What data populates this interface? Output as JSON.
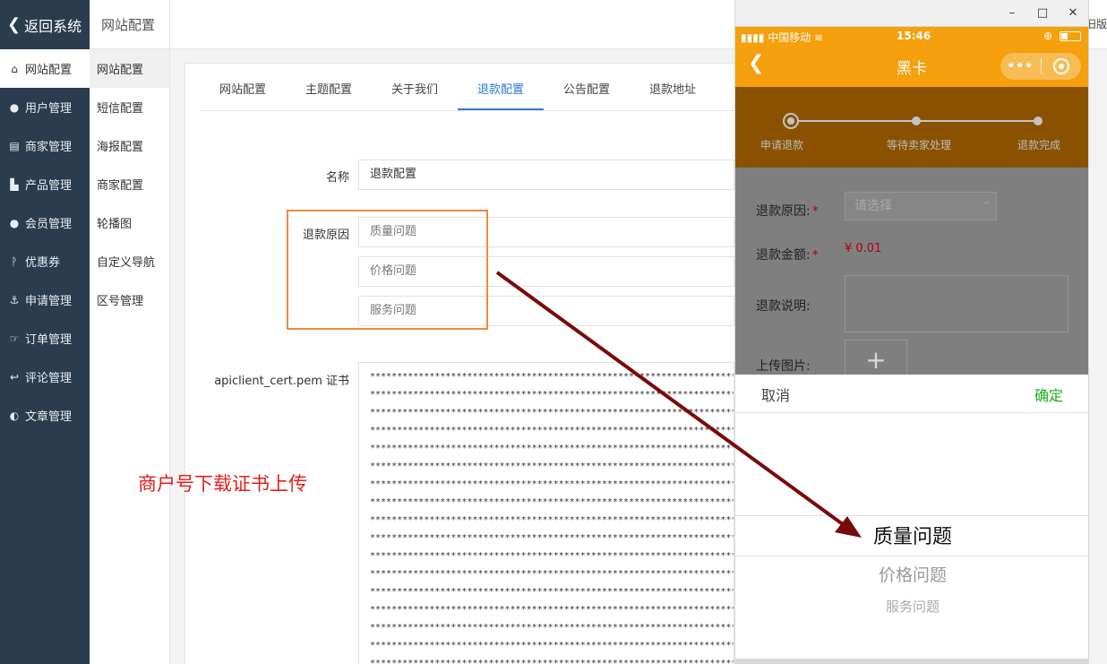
{
  "sidebar": {
    "back": "返回系统",
    "items": [
      {
        "label": "网站配置",
        "icon": "home-icon"
      },
      {
        "label": "用户管理",
        "icon": "user-icon"
      },
      {
        "label": "商家管理",
        "icon": "store-icon"
      },
      {
        "label": "产品管理",
        "icon": "cart-icon"
      },
      {
        "label": "会员管理",
        "icon": "members-icon"
      },
      {
        "label": "优惠券",
        "icon": "coupon-icon"
      },
      {
        "label": "申请管理",
        "icon": "anchor-icon"
      },
      {
        "label": "订单管理",
        "icon": "thumb-icon"
      },
      {
        "label": "评论管理",
        "icon": "reply-icon"
      },
      {
        "label": "文章管理",
        "icon": "half-circle-icon"
      }
    ]
  },
  "subbar": {
    "title": "网站配置",
    "items": [
      "网站配置",
      "短信配置",
      "海报配置",
      "商家配置",
      "轮播图",
      "自定义导航",
      "区号管理"
    ]
  },
  "topbar": {
    "old_version": "旧版"
  },
  "tabs": [
    "网站配置",
    "主题配置",
    "关于我们",
    "退款配置",
    "公告配置",
    "退款地址"
  ],
  "form": {
    "name_label": "名称",
    "name_value": "退款配置",
    "reasons_label": "退款原因",
    "reasons": [
      "质量问题",
      "价格问题",
      "服务问题"
    ],
    "cert_label": "apiclient_cert.pem 证书",
    "cert_line": "**********************************************************************"
  },
  "annotation": "商户号下载证书上传",
  "phone": {
    "window_controls": [
      "–",
      "□",
      "✕"
    ],
    "carrier": "▮▮▮▮ 中国移动 ≋",
    "time": "15:46",
    "gps": "⊕",
    "nav_title": "黑卡",
    "steps": [
      "申请退款",
      "等待卖家处理",
      "退款完成"
    ],
    "reason_label": "退款原因:",
    "reason_placeholder": "请选择",
    "amount_label": "退款金额:",
    "amount_value": "¥ 0.01",
    "desc_label": "退款说明:",
    "upload_label": "上传图片:",
    "picker_cancel": "取消",
    "picker_ok": "确定",
    "picker_options": [
      "质量问题",
      "价格问题",
      "服务问题"
    ]
  },
  "colors": {
    "sidebar_bg": "#2b3c4e",
    "accent_blue": "#2d7ad4",
    "phone_orange": "#f5a00c",
    "highlight_orange": "#f08a3c",
    "annotation_red": "#e0201c",
    "arrow": "#7a0a0a",
    "confirm_green": "#1aad19"
  }
}
